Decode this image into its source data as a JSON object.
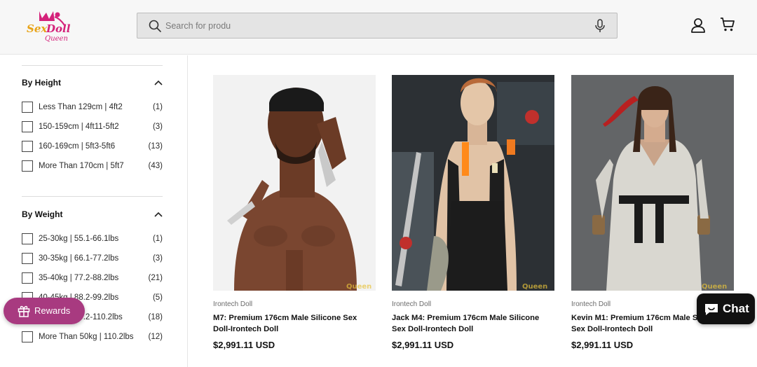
{
  "header": {
    "logo_text": "Sex Doll Queen",
    "search_placeholder": "Search for produ"
  },
  "filters": [
    {
      "title": "By Height",
      "options": [
        {
          "label": "Less Than 129cm | 4ft2",
          "count": "(1)"
        },
        {
          "label": "150-159cm | 4ft11-5ft2",
          "count": "(3)"
        },
        {
          "label": "160-169cm | 5ft3-5ft6",
          "count": "(13)"
        },
        {
          "label": "More Than 170cm | 5ft7",
          "count": "(43)"
        }
      ]
    },
    {
      "title": "By Weight",
      "options": [
        {
          "label": "25-30kg | 55.1-66.1lbs",
          "count": "(1)"
        },
        {
          "label": "30-35kg | 66.1-77.2lbs",
          "count": "(3)"
        },
        {
          "label": "35-40kg | 77.2-88.2lbs",
          "count": "(21)"
        },
        {
          "label": "40-45kg | 88.2-99.2lbs",
          "count": "(5)"
        },
        {
          "label": "45-50kg | 99.2-110.2lbs",
          "count": "(18)"
        },
        {
          "label": "More Than 50kg | 110.2lbs",
          "count": "(12)"
        }
      ]
    }
  ],
  "products": [
    {
      "vendor": "Irontech Doll",
      "title": "M7: Premium 176cm Male Silicone Sex Doll-Irontech Doll",
      "price": "$2,991.11 USD"
    },
    {
      "vendor": "Irontech Doll",
      "title": "Jack M4: Premium 176cm Male Silicone Sex Doll-Irontech Doll",
      "price": "$2,991.11 USD"
    },
    {
      "vendor": "Irontech Doll",
      "title": "Kevin M1: Premium 176cm Male Silicone Sex Doll-Irontech Doll",
      "price": "$2,991.11 USD"
    }
  ],
  "rewards_label": "Rewards",
  "chat_label": "Chat",
  "colors": {
    "rewards": "#a83a80",
    "chat": "#111111",
    "logo": "#d4227a"
  }
}
